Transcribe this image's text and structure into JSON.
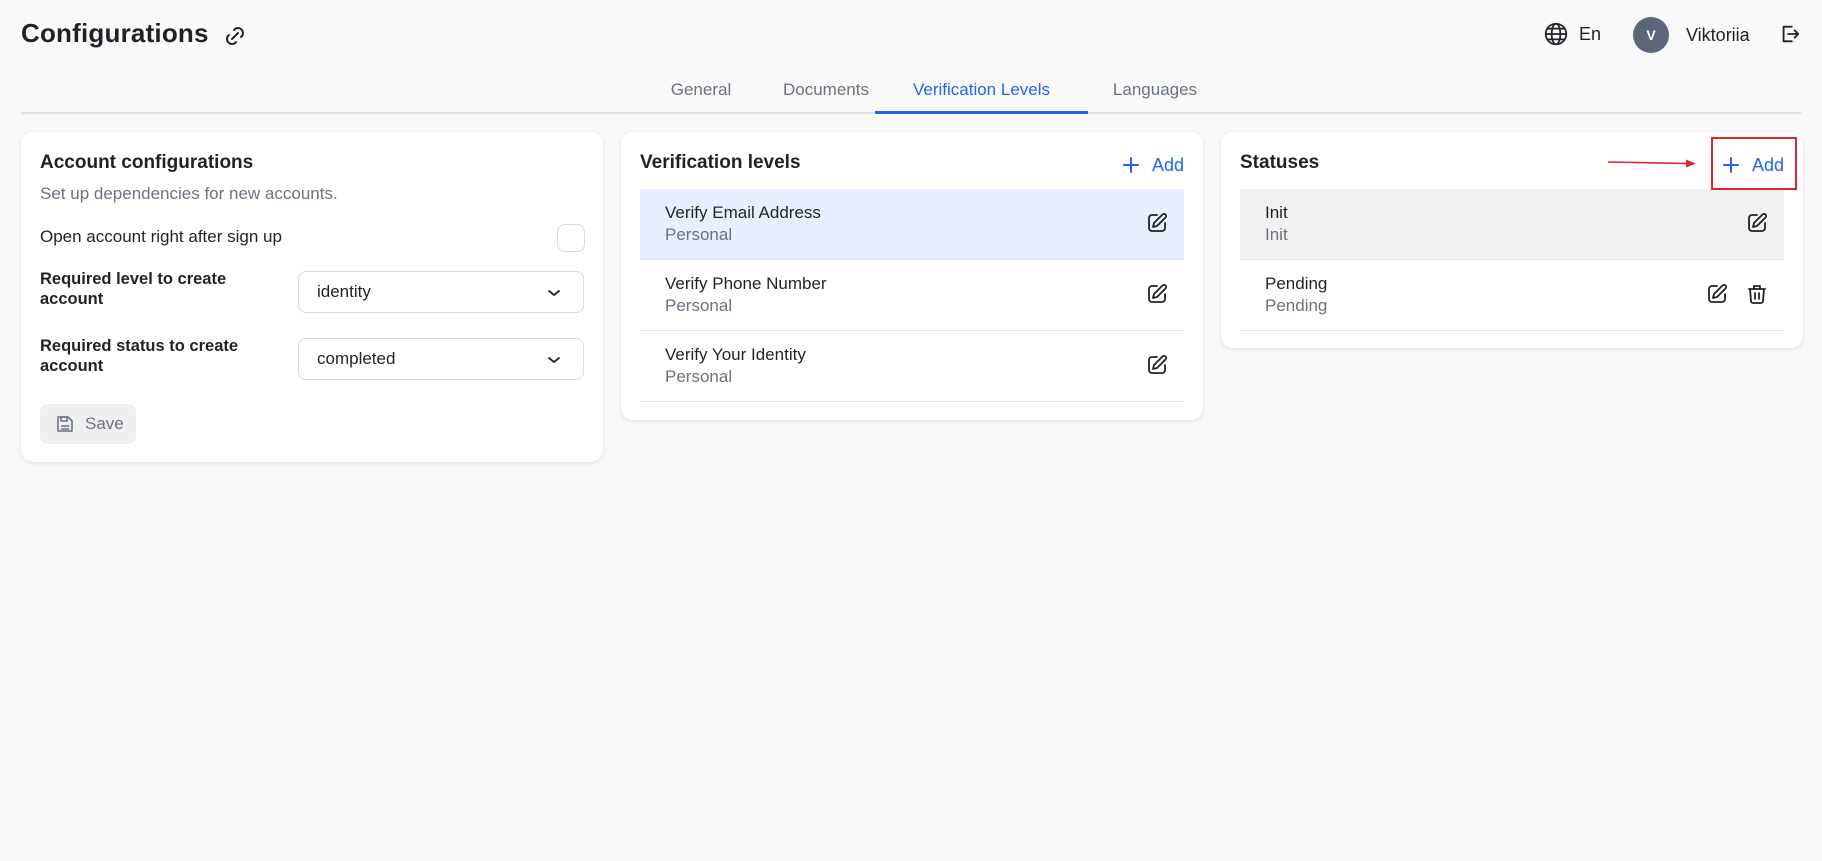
{
  "header": {
    "title": "Configurations",
    "language": "En",
    "user": {
      "initial": "V",
      "name": "Viktoriia"
    }
  },
  "tabs": [
    {
      "label": "General",
      "active": false
    },
    {
      "label": "Documents",
      "active": false
    },
    {
      "label": "Verification Levels",
      "active": true
    },
    {
      "label": "Languages",
      "active": false
    }
  ],
  "account": {
    "title": "Account configurations",
    "subtitle": "Set up dependencies for new accounts.",
    "open_account_label": "Open account right  after sign up",
    "required_level_label": "Required level to create account",
    "required_level_value": "identity",
    "required_status_label": "Required status to create account",
    "required_status_value": "completed",
    "save_label": "Save"
  },
  "levels": {
    "title": "Verification levels",
    "add_label": "Add",
    "items": [
      {
        "title": "Verify Email Address",
        "subtitle": "Personal"
      },
      {
        "title": "Verify Phone Number",
        "subtitle": "Personal"
      },
      {
        "title": "Verify Your Identity",
        "subtitle": "Personal"
      }
    ]
  },
  "statuses": {
    "title": "Statuses",
    "add_label": "Add",
    "items": [
      {
        "title": "Init",
        "subtitle": "Init"
      },
      {
        "title": "Pending",
        "subtitle": "Pending"
      }
    ]
  },
  "colors": {
    "accent": "#2563eb",
    "annotation": "#e0242c",
    "avatar": "#5c6678",
    "highlight_blue": "#e8efff"
  }
}
